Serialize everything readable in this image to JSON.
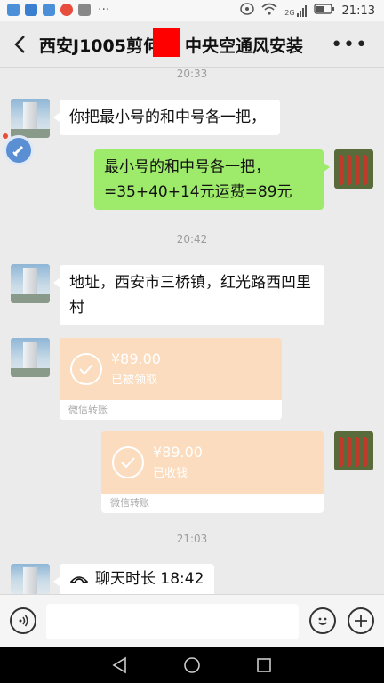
{
  "status": {
    "time": "21:13",
    "network": "2G"
  },
  "chat": {
    "title": "西安J1005剪何",
    "title_tail": "中央空通风安装"
  },
  "timestamps": [
    "20:33",
    "20:42",
    "21:03"
  ],
  "messages": {
    "m1": "你把最小号的和中号各一把，",
    "m2": "最小号的和中号各一把，=35+40+14元运费=89元",
    "m3": "地址，西安市三桥镇，红光路西凹里村",
    "transfer1": {
      "amount": "¥89.00",
      "status": "已被领取",
      "label": "微信转账"
    },
    "transfer2": {
      "amount": "¥89.00",
      "status": "已收钱",
      "label": "微信转账"
    },
    "call": "聊天时长 18:42"
  },
  "colors": {
    "sent_bubble": "#9eea6a",
    "transfer": "#fbdcbe",
    "redaction": "#ff0000"
  }
}
